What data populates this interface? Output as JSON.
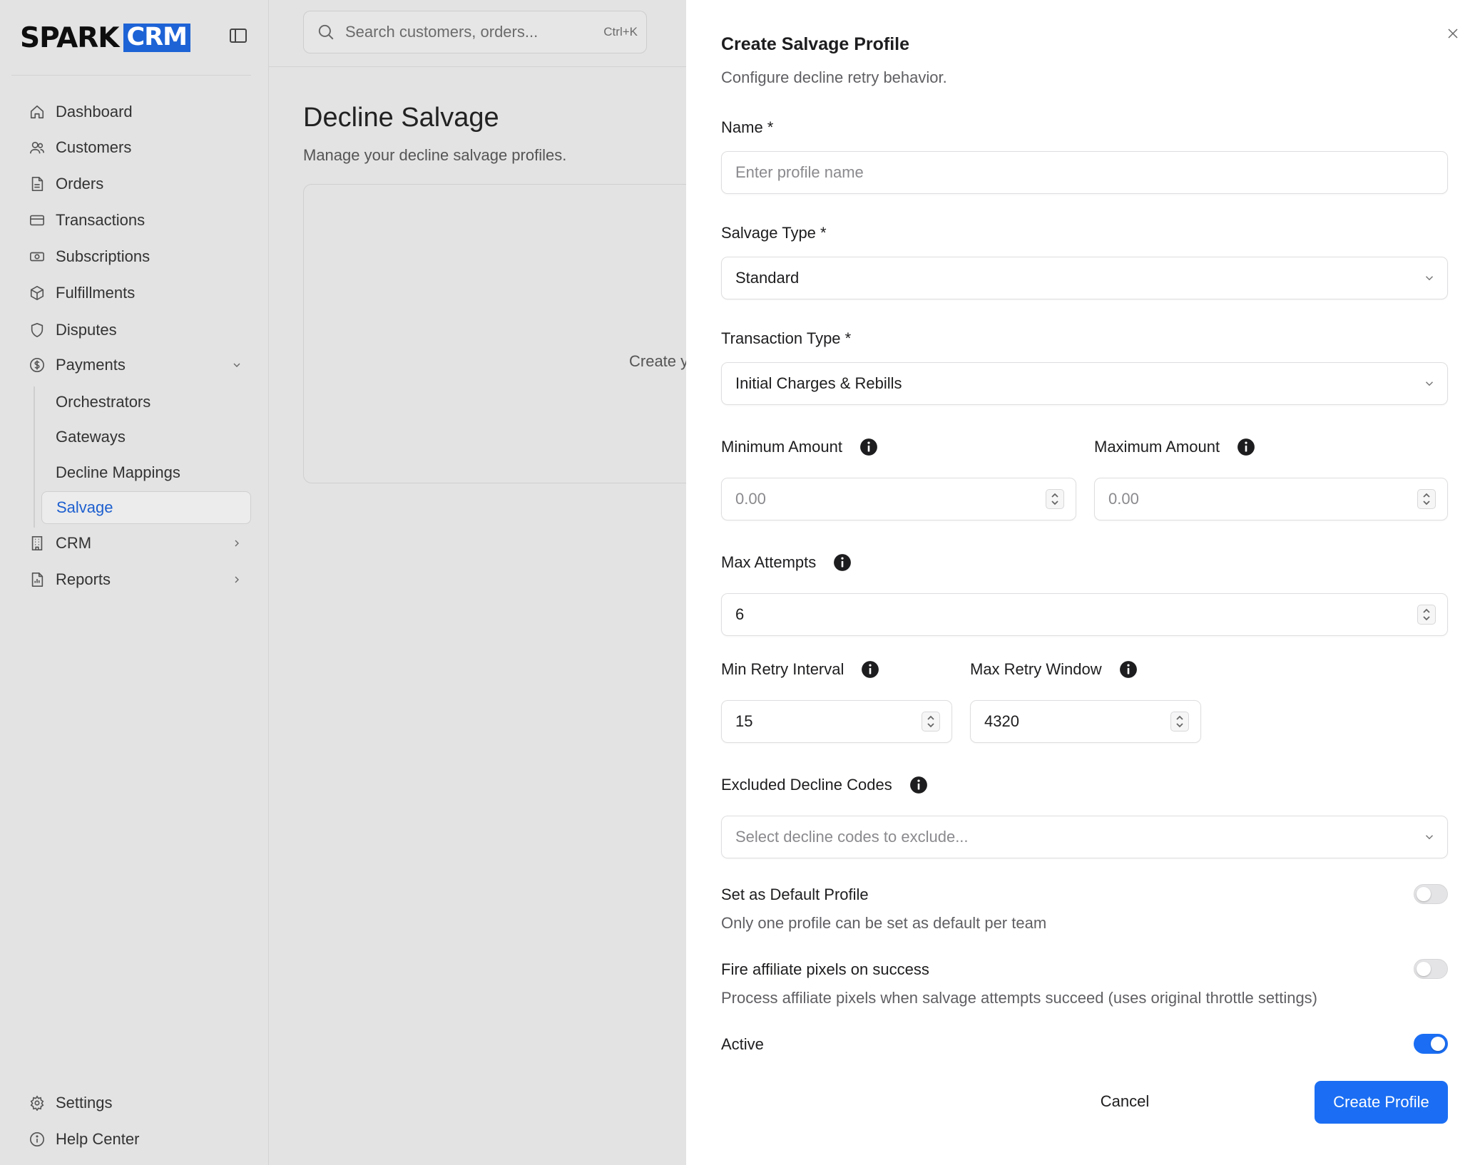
{
  "brand": {
    "word": "SPARK",
    "badge": "CRM"
  },
  "search": {
    "placeholder": "Search customers, orders...",
    "shortcut": "Ctrl+K"
  },
  "sidebar": {
    "items": [
      {
        "label": "Dashboard",
        "icon": "home-icon"
      },
      {
        "label": "Customers",
        "icon": "users-icon"
      },
      {
        "label": "Orders",
        "icon": "file-icon"
      },
      {
        "label": "Transactions",
        "icon": "credit-card-icon"
      },
      {
        "label": "Subscriptions",
        "icon": "banknote-icon"
      },
      {
        "label": "Fulfillments",
        "icon": "package-icon"
      },
      {
        "label": "Disputes",
        "icon": "shield-icon"
      },
      {
        "label": "Payments",
        "icon": "dollar-circle-icon"
      }
    ],
    "payments_sub": [
      "Orchestrators",
      "Gateways",
      "Decline Mappings",
      "Salvage"
    ],
    "more": [
      {
        "label": "CRM",
        "icon": "building-icon"
      },
      {
        "label": "Reports",
        "icon": "report-icon"
      }
    ],
    "footer": [
      {
        "label": "Settings",
        "icon": "gear-icon"
      },
      {
        "label": "Help Center",
        "icon": "info-circle-icon"
      }
    ]
  },
  "main": {
    "title": "Decline Salvage",
    "subtitle": "Manage your decline salvage profiles.",
    "empty_text": "Create y"
  },
  "drawer": {
    "title": "Create Salvage Profile",
    "subtitle": "Configure decline retry behavior.",
    "name": {
      "label": "Name *",
      "placeholder": "Enter profile name"
    },
    "salvage_type": {
      "label": "Salvage Type *",
      "value": "Standard"
    },
    "transaction_type": {
      "label": "Transaction Type *",
      "value": "Initial Charges & Rebills"
    },
    "min_amount": {
      "label": "Minimum Amount",
      "placeholder": "0.00"
    },
    "max_amount": {
      "label": "Maximum Amount",
      "placeholder": "0.00"
    },
    "max_attempts": {
      "label": "Max Attempts",
      "value": "6"
    },
    "min_retry": {
      "label": "Min Retry Interval",
      "value": "15"
    },
    "max_window": {
      "label": "Max Retry Window",
      "value": "4320"
    },
    "excluded": {
      "label": "Excluded Decline Codes",
      "placeholder": "Select decline codes to exclude..."
    },
    "default_profile": {
      "label": "Set as Default Profile",
      "desc": "Only one profile can be set as default per team",
      "on": false
    },
    "affiliate": {
      "label": "Fire affiliate pixels on success",
      "desc": "Process affiliate pixels when salvage attempts succeed (uses original throttle settings)",
      "on": false
    },
    "active": {
      "label": "Active",
      "on": true
    },
    "cancel_label": "Cancel",
    "create_label": "Create Profile"
  },
  "colors": {
    "accent": "#1b6ef3",
    "brand": "#1d63d6",
    "active_nav": "#1d5fcf"
  }
}
